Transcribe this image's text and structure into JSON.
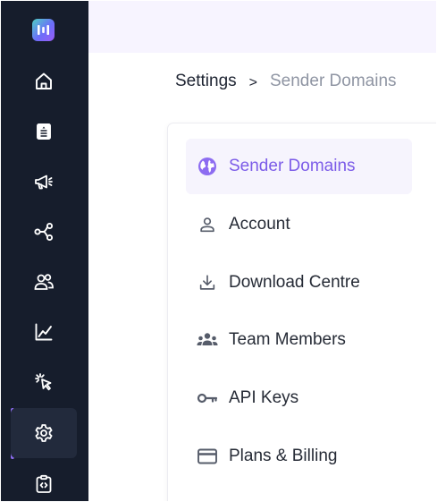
{
  "colors": {
    "sidebar_bg": "#161d2c",
    "sidebar_icon": "#ffffff",
    "accent": "#8d6cf1",
    "active_text": "#7c5ce8",
    "breadcrumb_muted": "#8f95a3",
    "topbar_bg": "#f7f4ff"
  },
  "sidebar": {
    "logo_icon": "app-logo",
    "items": [
      {
        "icon": "home-icon",
        "active": false
      },
      {
        "icon": "document-list-icon",
        "active": false
      },
      {
        "icon": "megaphone-icon",
        "active": false
      },
      {
        "icon": "share-nodes-icon",
        "active": false
      },
      {
        "icon": "users-icon",
        "active": false
      },
      {
        "icon": "chart-line-icon",
        "active": false
      },
      {
        "icon": "cursor-click-icon",
        "active": false
      },
      {
        "icon": "gear-icon",
        "active": true
      },
      {
        "icon": "code-clipboard-icon",
        "active": false
      }
    ]
  },
  "breadcrumb": {
    "home": "Settings",
    "separator": ">",
    "current": "Sender Domains"
  },
  "settings_menu": {
    "items": [
      {
        "label": "Sender Domains",
        "icon": "globe-icon",
        "active": true
      },
      {
        "label": "Account",
        "icon": "user-icon",
        "active": false
      },
      {
        "label": "Download Centre",
        "icon": "download-icon",
        "active": false
      },
      {
        "label": "Team Members",
        "icon": "team-icon",
        "active": false
      },
      {
        "label": "API Keys",
        "icon": "key-icon",
        "active": false
      },
      {
        "label": "Plans & Billing",
        "icon": "credit-card-icon",
        "active": false
      }
    ]
  }
}
